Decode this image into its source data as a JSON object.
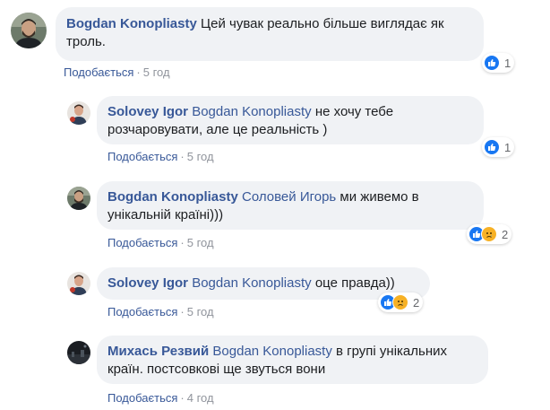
{
  "comments": [
    {
      "author": "Bogdan Konopliasty",
      "mention": "",
      "text": "Цей чувак реально більше виглядає як троль.",
      "line1": "Цей чувак реально більше виглядає як",
      "line2": "троль.",
      "like_label": "Подобається",
      "sep": "·",
      "time": "5 год",
      "reactions": [
        "like"
      ],
      "reaction_count": "1"
    },
    {
      "author": "Solovey Igor",
      "mention": "Bogdan Konopliasty",
      "text": "не хочу тебе розчаровувати, але це реальність )",
      "line1": "не хочу тебе",
      "line2": "розчаровувати, але це реальність )",
      "like_label": "Подобається",
      "sep": "·",
      "time": "5 год",
      "reactions": [
        "like"
      ],
      "reaction_count": "1"
    },
    {
      "author": "Bogdan Konopliasty",
      "mention": "Соловей Игорь",
      "text": "ми живемо в унікальній країні)))",
      "line1": "ми живемо в",
      "line2": "унікальній країні)))",
      "like_label": "Подобається",
      "sep": "·",
      "time": "5 год",
      "reactions": [
        "like",
        "sad"
      ],
      "reaction_count": "2"
    },
    {
      "author": "Solovey Igor",
      "mention": "Bogdan Konopliasty",
      "text": "оце правда))",
      "line1": "оце правда))",
      "line2": "",
      "like_label": "Подобається",
      "sep": "·",
      "time": "5 год",
      "reactions": [
        "like",
        "sad"
      ],
      "reaction_count": "2"
    },
    {
      "author": "Михась Резвий",
      "mention": "Bogdan Konopliasty",
      "text": "в групі унікальних країн. постсовкові ще звуться вони",
      "line1": "в групі унікальних",
      "line2": "країн. постсовкові ще звуться вони",
      "like_label": "Подобається",
      "sep": "·",
      "time": "4 год",
      "reactions": [],
      "reaction_count": ""
    }
  ],
  "colors": {
    "link": "#385898",
    "bubble": "#f0f2f5",
    "meta_gray": "#90949c",
    "like_blue": "#1877f2",
    "sad_yellow": "#f7b125"
  }
}
